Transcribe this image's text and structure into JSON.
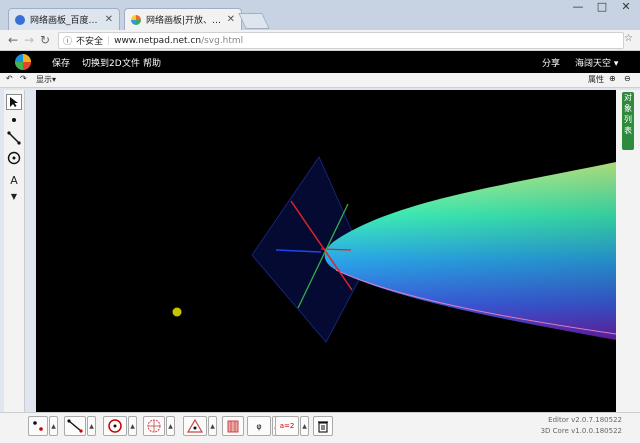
{
  "browser": {
    "tabs": [
      {
        "title": "网络画板_百度搜索",
        "favicon_color": "#3b6fd6"
      },
      {
        "title": "网络画板|开放、共享的…",
        "favicon_color": "#e79a1c"
      }
    ],
    "window_controls": [
      "—",
      "□",
      "✕"
    ],
    "url_security": "不安全",
    "url_host": "www.netpad.net.cn",
    "url_path": "/svg.html"
  },
  "menubar": {
    "items": [
      "保存",
      "切换到2D",
      "文件",
      "帮助"
    ],
    "share": "分享",
    "user": "海阔天空 ▾"
  },
  "subbar": {
    "display_label": "显示▾",
    "property_label": "属性"
  },
  "right_panel": {
    "label_chars": [
      "对",
      "象",
      "列",
      "表"
    ]
  },
  "left_tools": [
    "select-arrow-icon",
    "point-icon",
    "segment-icon",
    "circle-icon",
    "text-icon",
    "more-icon"
  ],
  "bottom_tools": [
    "point-tool-icon",
    "segment-tool-icon",
    "circle-tool-icon",
    "transform-tool-icon",
    "construct-tool-icon",
    "solid-tool-icon",
    "function-tool-icon",
    "formula-tool-icon",
    "trash-icon"
  ],
  "footer": {
    "editor_version": "Editor v2.0.7.180522",
    "core_version": "3D Core v1.0.0.180522"
  },
  "colors": {
    "canvas_bg": "#000000",
    "surface_top": "#a8ff8a",
    "surface_bottom": "#6d1fb0",
    "panel_green": "#2e8b3e"
  }
}
